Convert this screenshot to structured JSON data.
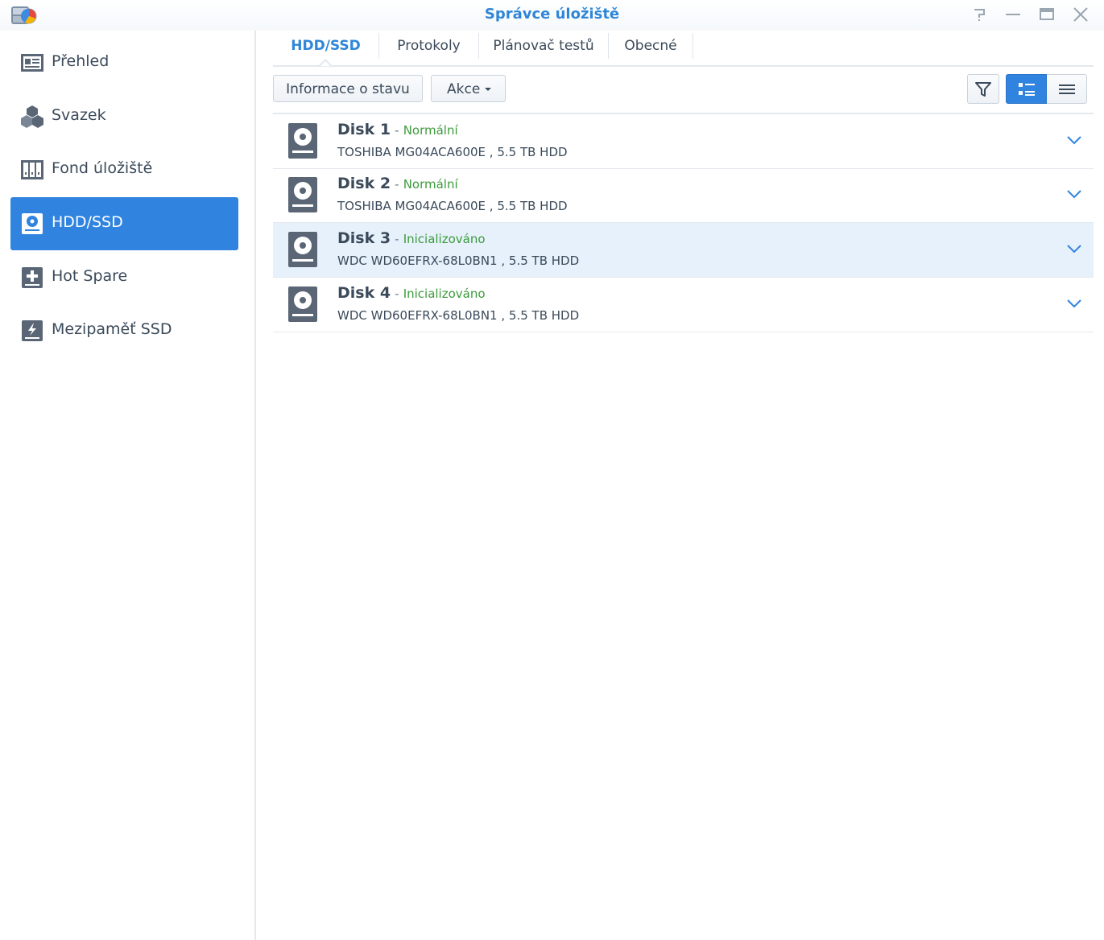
{
  "window": {
    "title": "Správce úložiště",
    "icons": {
      "app": "storage-manager-app-icon",
      "help": "help-icon",
      "minimize": "minimize-icon",
      "maximize": "maximize-icon",
      "close": "close-icon"
    }
  },
  "sidebar": {
    "items": [
      {
        "label": "Přehled",
        "icon": "overview-icon",
        "active": false
      },
      {
        "label": "Svazek",
        "icon": "volume-icon",
        "active": false
      },
      {
        "label": "Fond úložiště",
        "icon": "storage-pool-icon",
        "active": false
      },
      {
        "label": "HDD/SSD",
        "icon": "hdd-icon",
        "active": true
      },
      {
        "label": "Hot Spare",
        "icon": "hot-spare-icon",
        "active": false
      },
      {
        "label": "Mezipaměť SSD",
        "icon": "ssd-cache-icon",
        "active": false
      }
    ]
  },
  "tabs": [
    {
      "label": "HDD/SSD",
      "active": true
    },
    {
      "label": "Protokoly",
      "active": false
    },
    {
      "label": "Plánovač testů",
      "active": false
    },
    {
      "label": "Obecné",
      "active": false
    }
  ],
  "toolbar": {
    "status_info_label": "Informace o stavu",
    "action_label": "Akce",
    "icons": {
      "filter": "filter-icon",
      "detail_view": "detail-list-view-icon",
      "list_view": "compact-list-view-icon"
    }
  },
  "disks": [
    {
      "name": "Disk 1",
      "separator": "-",
      "status": "Normální",
      "model": "TOSHIBA MG04ACA600E",
      "size": ", 5.5 TB HDD",
      "selected": false
    },
    {
      "name": "Disk 2",
      "separator": "-",
      "status": "Normální",
      "model": "TOSHIBA MG04ACA600E",
      "size": ", 5.5 TB HDD",
      "selected": false
    },
    {
      "name": "Disk 3",
      "separator": "-",
      "status": "Inicializováno",
      "model": "WDC WD60EFRX-68L0BN1",
      "size": ", 5.5 TB HDD",
      "selected": true
    },
    {
      "name": "Disk 4",
      "separator": "-",
      "status": "Inicializováno",
      "model": "WDC WD60EFRX-68L0BN1",
      "size": ", 5.5 TB HDD",
      "selected": false
    }
  ],
  "colors": {
    "accent": "#3084e0",
    "title": "#2f86d8",
    "status_ok": "#3c9b3c",
    "selected_row": "#e6f1fb",
    "text": "#3b4a5a"
  }
}
